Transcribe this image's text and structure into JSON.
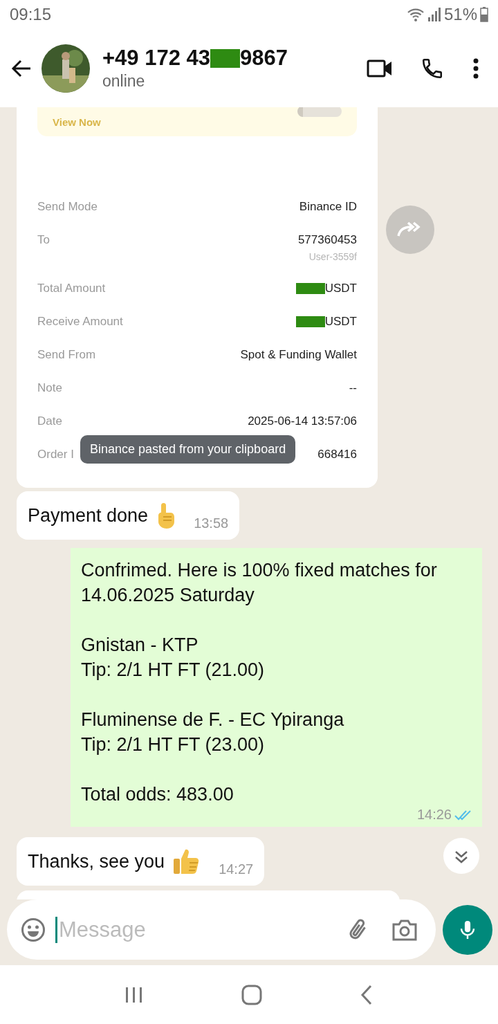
{
  "status_bar": {
    "time": "09:15",
    "battery": "51%"
  },
  "header": {
    "title_start": "+49 172 43",
    "title_end": "9867",
    "status": "online"
  },
  "receipt": {
    "banner_link": "View Now",
    "rows": [
      {
        "label": "Send Mode",
        "value": "Binance ID",
        "redacted": false
      },
      {
        "label": "To",
        "value": "577360453",
        "sub": "User-3559f",
        "redacted": false
      },
      {
        "label": "Total Amount",
        "value": "USDT",
        "redacted": true
      },
      {
        "label": "Receive Amount",
        "value": "USDT",
        "redacted": true
      },
      {
        "label": "Send From",
        "value": "Spot & Funding Wallet",
        "redacted": false
      },
      {
        "label": "Note",
        "value": "--",
        "redacted": false
      },
      {
        "label": "Date",
        "value": "2025-06-14 13:57:06",
        "redacted": false
      },
      {
        "label": "Order I",
        "value": "668416",
        "redacted": false
      }
    ],
    "toast": "Binance pasted from your clipboard"
  },
  "messages": [
    {
      "kind": "pointing",
      "text": "Payment done",
      "time": "13:58"
    },
    {
      "kind": "outgoing",
      "text": "Confrimed. Here is 100% fixed matches for 14.06.2025 Saturday\n\nGnistan - KTP\nTip: 2/1 HT FT (21.00)\n\nFluminense de F. - EC Ypiranga\nTip: 2/1 HT FT (23.00)\n\nTotal odds: 483.00",
      "time": "14:26",
      "read": true
    },
    {
      "kind": "thumbsup",
      "text": "Thanks, see you",
      "time": "14:27"
    },
    {
      "kind": "cut"
    }
  ],
  "composer": {
    "placeholder": "Message"
  }
}
